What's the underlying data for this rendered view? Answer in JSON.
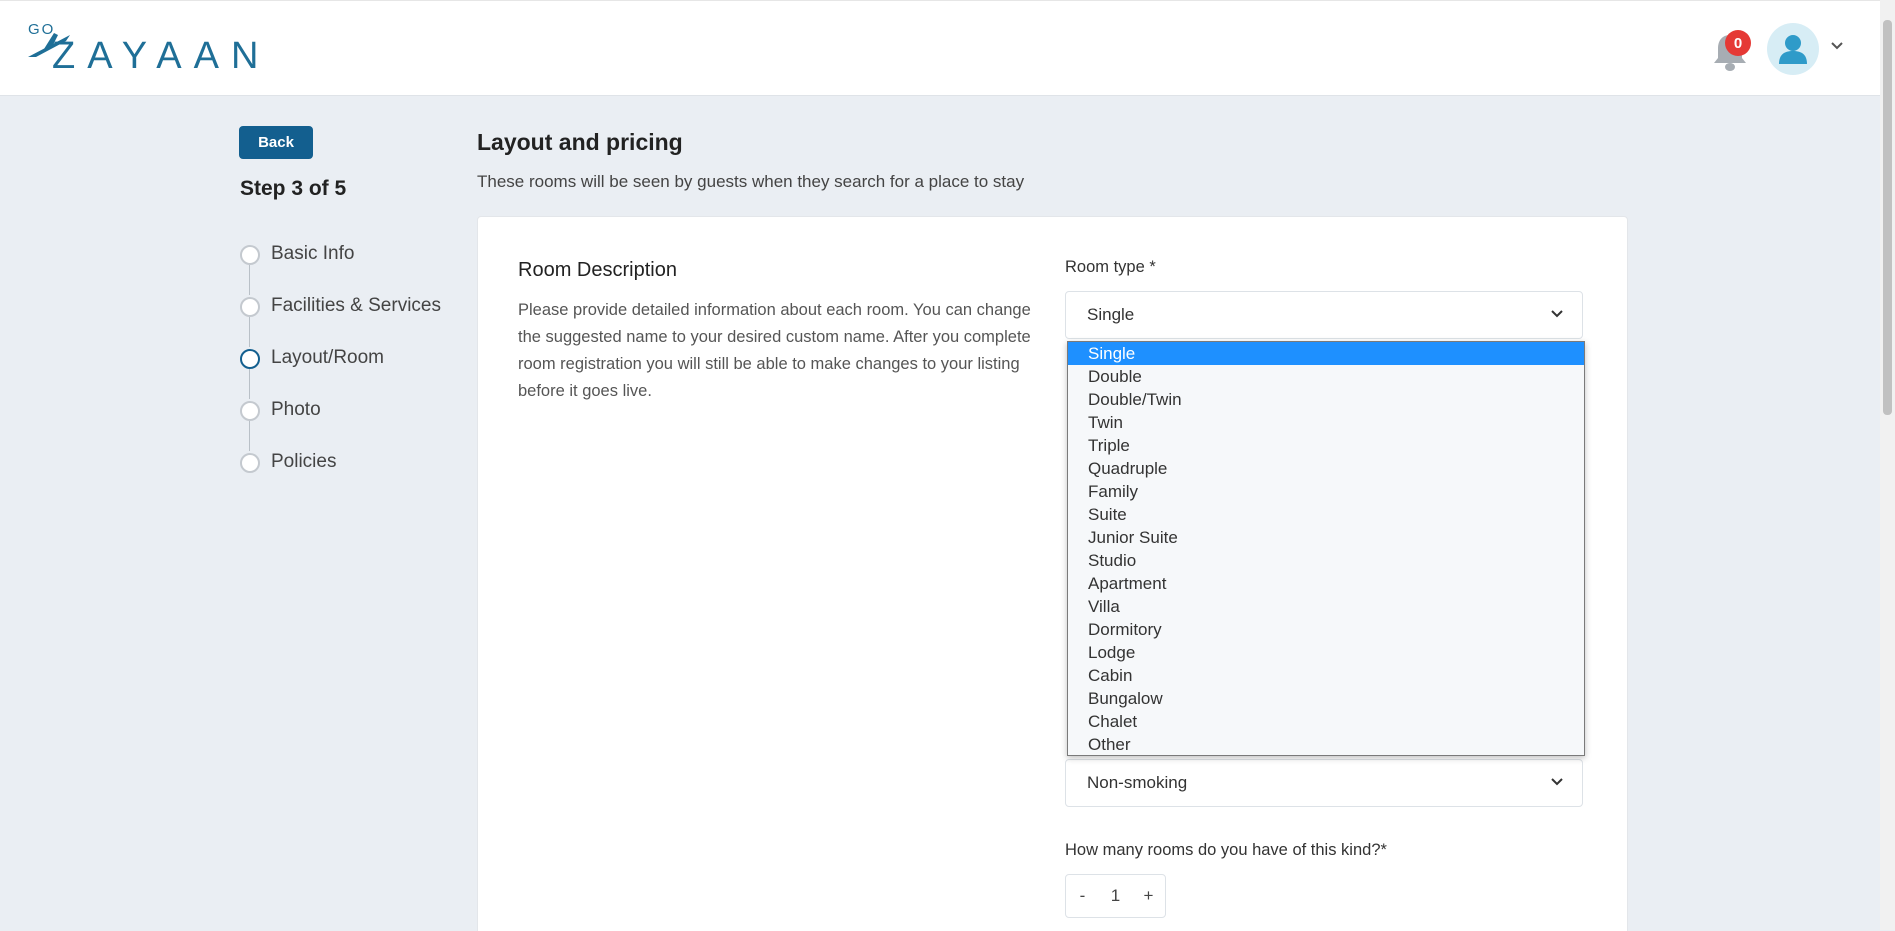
{
  "header": {
    "logo_small": "GO",
    "logo_brand": "ZAYAAN",
    "notification_count": "0"
  },
  "sidebar": {
    "back_label": "Back",
    "step_title": "Step 3 of 5",
    "steps": [
      {
        "label": "Basic Info",
        "active": false
      },
      {
        "label": "Facilities & Services",
        "active": false
      },
      {
        "label": "Layout/Room",
        "active": true
      },
      {
        "label": "Photo",
        "active": false
      },
      {
        "label": "Policies",
        "active": false
      }
    ]
  },
  "main": {
    "title": "Layout and pricing",
    "subtitle": "These rooms will be seen by guests when they search for a place to stay",
    "room_description": {
      "title": "Room Description",
      "text": "Please provide detailed information about each room. You can change the suggested name to your desired custom name. After you complete room registration you will still be able to make changes to your listing before it goes live."
    },
    "room_type": {
      "label": "Room type *",
      "value": "Single",
      "options": [
        "Single",
        "Double",
        "Double/Twin",
        "Twin",
        "Triple",
        "Quadruple",
        "Family",
        "Suite",
        "Junior Suite",
        "Studio",
        "Apartment",
        "Villa",
        "Dormitory",
        "Lodge",
        "Cabin",
        "Bungalow",
        "Chalet",
        "Other"
      ]
    },
    "smoking_policy": {
      "value": "Non-smoking"
    },
    "room_count": {
      "label": "How many rooms do you have of this kind?*",
      "minus": "-",
      "value": "1",
      "plus": "+"
    }
  },
  "colors": {
    "primary": "#135f8f",
    "badge": "#e53935",
    "selected_option": "#1e90ff",
    "page_bg": "#eaeef3"
  }
}
